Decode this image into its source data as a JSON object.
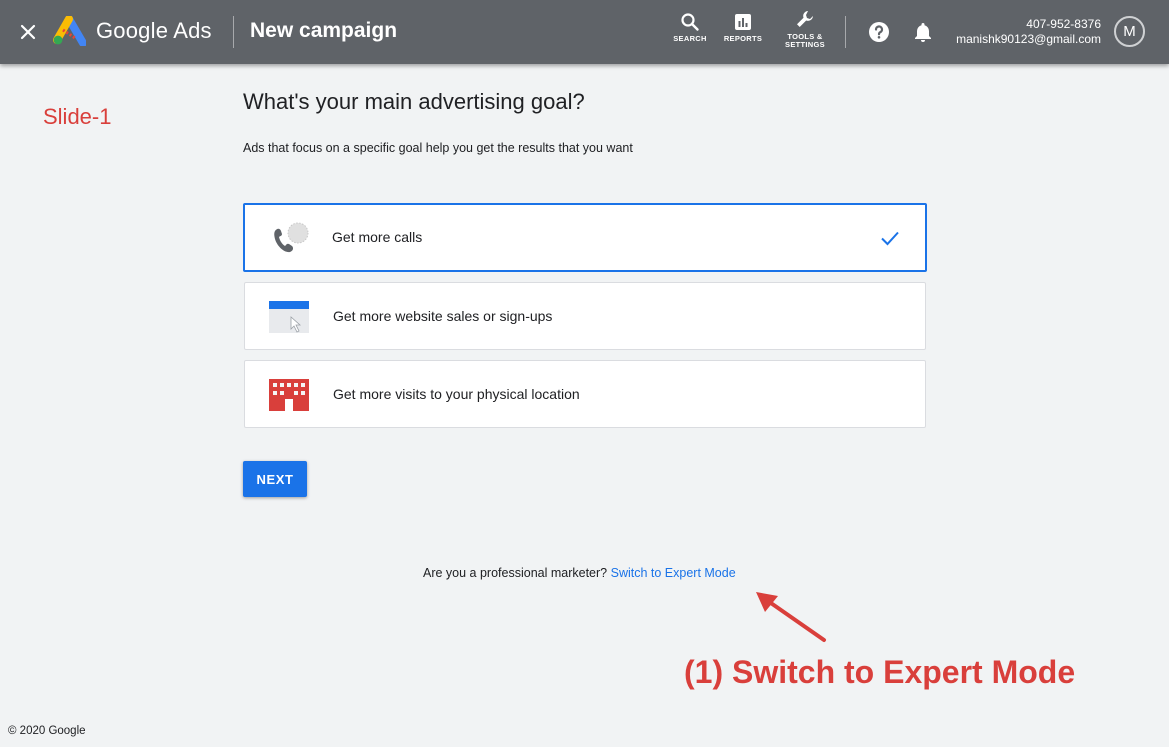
{
  "header": {
    "close_icon": "close-icon",
    "brand": "Google Ads",
    "page_title": "New campaign",
    "tools": [
      {
        "icon": "search-icon",
        "label": "SEARCH"
      },
      {
        "icon": "reports-icon",
        "label": "REPORTS"
      },
      {
        "icon": "wrench-icon",
        "label_line1": "TOOLS &",
        "label_line2": "SETTINGS"
      }
    ],
    "help_icon": "help-icon",
    "notifications_icon": "bell-icon",
    "account": {
      "phone": "407-952-8376",
      "email": "manishk90123@gmail.com",
      "avatar_initial": "M"
    }
  },
  "annotation": {
    "slide_label": "Slide-1",
    "callout": "(1) Switch to Expert Mode",
    "color": "#d93f3b"
  },
  "main": {
    "title": "What's your main advertising goal?",
    "subtitle": "Ads that focus on a specific goal help you get the results that you want",
    "goals": [
      {
        "icon": "phone-call-icon",
        "label": "Get more calls",
        "selected": true
      },
      {
        "icon": "website-icon",
        "label": "Get more website sales or sign-ups",
        "selected": false
      },
      {
        "icon": "store-location-icon",
        "label": "Get more visits to your physical location",
        "selected": false
      }
    ],
    "next_label": "NEXT",
    "expert_prompt": "Are you a professional marketer?",
    "expert_link": "Switch to Expert Mode"
  },
  "footer": {
    "copyright": "© 2020 Google"
  },
  "colors": {
    "header_bg": "#5f6368",
    "accent": "#1a73e8",
    "page_bg": "#f1f3f4"
  }
}
